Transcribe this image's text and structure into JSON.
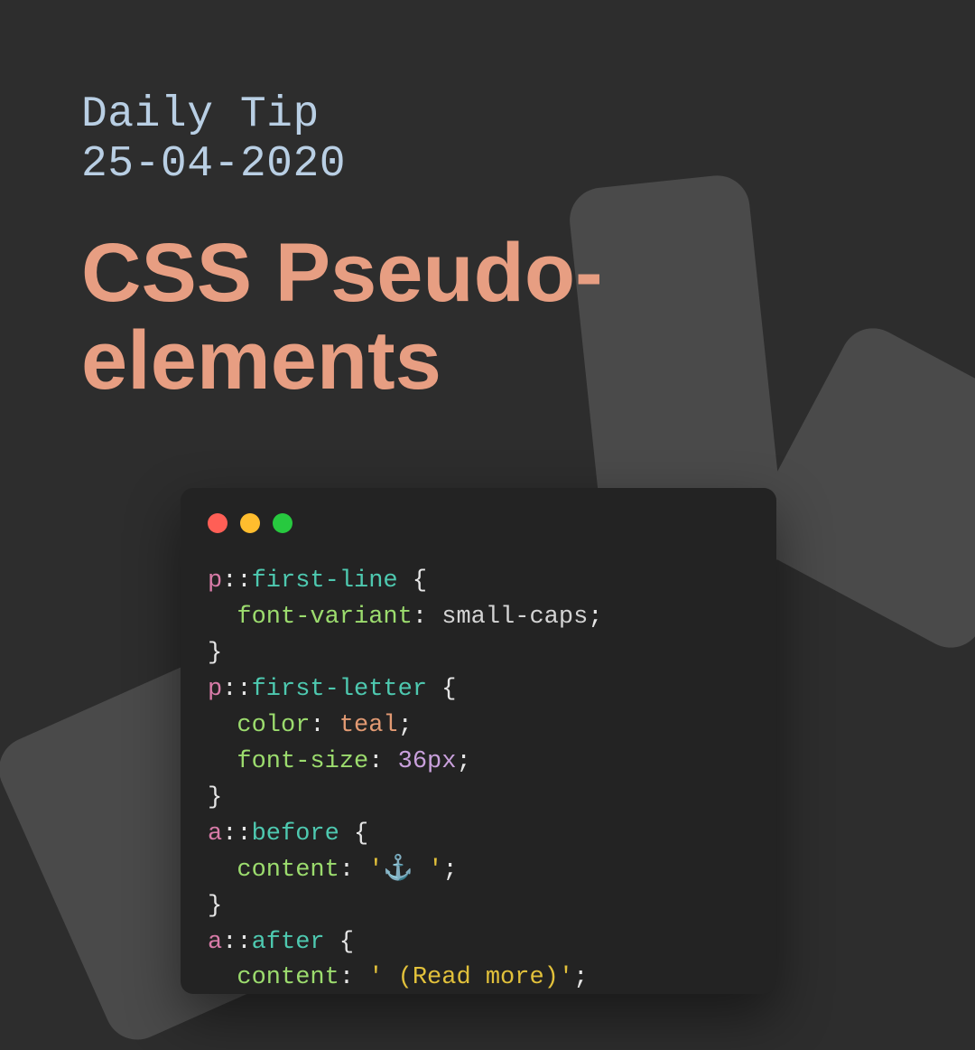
{
  "header": {
    "kicker_line1": "Daily Tip",
    "kicker_line2": "25-04-2020",
    "title_line1": "CSS Pseudo-",
    "title_line2": "elements"
  },
  "colors": {
    "background": "#2d2d2d",
    "kicker": "#b9cfe4",
    "title": "#e79e82",
    "code_bg": "#232323",
    "shape": "#4a4a4a"
  },
  "traffic_lights": [
    "#ff5f56",
    "#ffbd2e",
    "#27c93f"
  ],
  "code": {
    "r1": {
      "sel": "p",
      "colon": "::",
      "pseu": "first-line",
      "open": " {"
    },
    "r2": {
      "indent": "  ",
      "prop": "font-variant",
      "colon": ": ",
      "val": "small-caps",
      "semi": ";"
    },
    "r3": {
      "close": "}"
    },
    "r4": {
      "sel": "p",
      "colon": "::",
      "pseu": "first-letter",
      "open": " {"
    },
    "r5": {
      "indent": "  ",
      "prop": "color",
      "colon": ": ",
      "val": "teal",
      "semi": ";"
    },
    "r6": {
      "indent": "  ",
      "prop": "font-size",
      "colon": ": ",
      "num": "36px",
      "semi": ";"
    },
    "r7": {
      "close": "}"
    },
    "r8": {
      "sel": "a",
      "colon": "::",
      "pseu": "before",
      "open": " {"
    },
    "r9": {
      "indent": "  ",
      "prop": "content",
      "colon": ": ",
      "str": "'⚓ '",
      "semi": ";"
    },
    "r10": {
      "close": "}"
    },
    "r11": {
      "sel": "a",
      "colon": "::",
      "pseu": "after",
      "open": " {"
    },
    "r12": {
      "indent": "  ",
      "prop": "content",
      "colon": ": ",
      "str": "' (Read more)'",
      "semi": ";"
    }
  }
}
